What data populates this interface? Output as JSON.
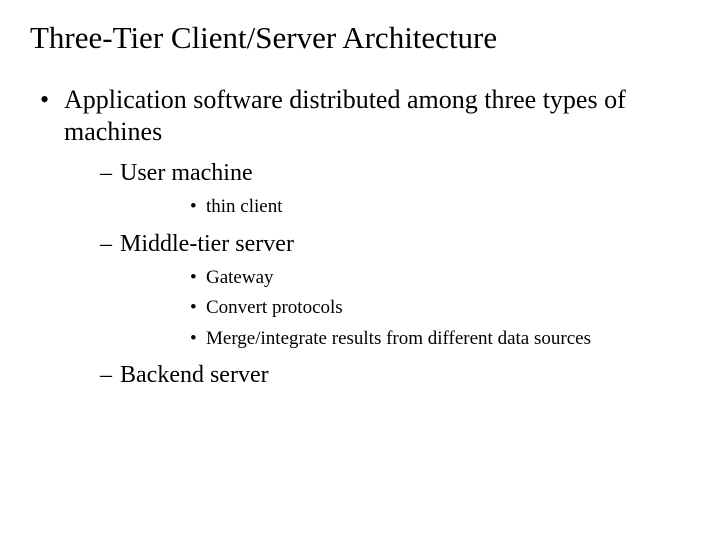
{
  "title": "Three-Tier Client/Server Architecture",
  "l1": {
    "0": "Application software distributed among three types of machines"
  },
  "l2": {
    "0": "User machine",
    "1": "Middle-tier server",
    "2": "Backend server"
  },
  "l3a": {
    "0": "thin client"
  },
  "l3b": {
    "0": "Gateway",
    "1": "Convert protocols",
    "2": "Merge/integrate results from different data sources"
  }
}
